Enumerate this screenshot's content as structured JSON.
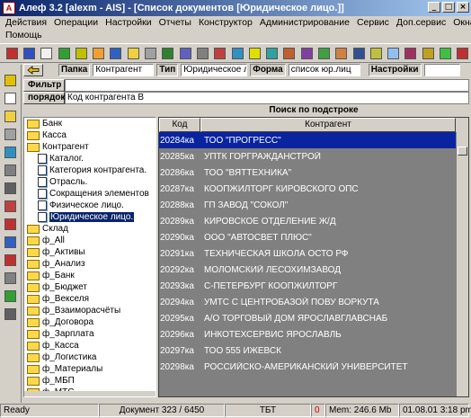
{
  "window": {
    "title": "Алеф 3.2 [alexm - AIS] - [Список документов [Юридическое лицо.]]",
    "app_icon_label": "А",
    "min_glyph": "_",
    "max_glyph": "□",
    "close_glyph": "×"
  },
  "menu": {
    "row1": [
      "Действия",
      "Операции",
      "Настройки",
      "Отчеты",
      "Конструктор",
      "Администрирование",
      "Сервис",
      "Доп.сервис",
      "Окна"
    ],
    "row2": [
      "Помощь"
    ]
  },
  "params": {
    "folder_label": "Папка",
    "folder_value": "Контрагент",
    "type_label": "Тип",
    "type_value": "Юридическое л",
    "form_label": "Форма",
    "form_value": "список юр.лиц",
    "settings_label": "Настройки"
  },
  "filter": {
    "label": "Фильтр",
    "value": ""
  },
  "order": {
    "label": "порядок",
    "value": "Код контрагента В"
  },
  "search": {
    "label": "Поиск по подстроке"
  },
  "tree": [
    {
      "label": "Банк",
      "kind": "folder",
      "indent": 0
    },
    {
      "label": "Касса",
      "kind": "folder",
      "indent": 0
    },
    {
      "label": "Контрагент",
      "kind": "folder",
      "indent": 0
    },
    {
      "label": "Каталог.",
      "kind": "doc",
      "indent": 1
    },
    {
      "label": "Категория контрагента.",
      "kind": "doc",
      "indent": 1
    },
    {
      "label": "Отрасль.",
      "kind": "doc",
      "indent": 1
    },
    {
      "label": "Сокращения элементов",
      "kind": "doc",
      "indent": 1
    },
    {
      "label": "Физическое лицо.",
      "kind": "doc",
      "indent": 1
    },
    {
      "label": "Юридическое лицо.",
      "kind": "doc",
      "indent": 1,
      "selected": true
    },
    {
      "label": "Склад",
      "kind": "folder",
      "indent": 0
    },
    {
      "label": "ф_All",
      "kind": "folder",
      "indent": 0
    },
    {
      "label": "ф_Активы",
      "kind": "folder",
      "indent": 0
    },
    {
      "label": "ф_Анализ",
      "kind": "folder",
      "indent": 0
    },
    {
      "label": "ф_Банк",
      "kind": "folder",
      "indent": 0
    },
    {
      "label": "ф_Бюджет",
      "kind": "folder",
      "indent": 0
    },
    {
      "label": "ф_Векселя",
      "kind": "folder",
      "indent": 0
    },
    {
      "label": "ф_Взаиморасчёты",
      "kind": "folder",
      "indent": 0
    },
    {
      "label": "ф_Договора",
      "kind": "folder",
      "indent": 0
    },
    {
      "label": "ф_Зарплата",
      "kind": "folder",
      "indent": 0
    },
    {
      "label": "ф_Касса",
      "kind": "folder",
      "indent": 0
    },
    {
      "label": "ф_Логистика",
      "kind": "folder",
      "indent": 0
    },
    {
      "label": "ф_Материалы",
      "kind": "folder",
      "indent": 0
    },
    {
      "label": "ф_МБП",
      "kind": "folder",
      "indent": 0
    },
    {
      "label": "ф_МТС",
      "kind": "folder",
      "indent": 0
    }
  ],
  "grid": {
    "col_code": "Код",
    "col_name": "Контрагент",
    "rows": [
      {
        "code": "20284ка",
        "name": "ТОО \"ПРОГРЕСС\"",
        "selected": true
      },
      {
        "code": "20285ка",
        "name": "УПТК ГОРГРАЖДАНСТРОЙ"
      },
      {
        "code": "20286ка",
        "name": "ТОО \"ВЯТТЕХНИКА\""
      },
      {
        "code": "20287ка",
        "name": "КООПЖИЛТОРГ КИРОВСКОГО ОПС"
      },
      {
        "code": "20288ка",
        "name": "ГП ЗАВОД \"СОКОЛ\""
      },
      {
        "code": "20289ка",
        "name": "КИРОВСКОЕ ОТДЕЛЕНИЕ Ж/Д"
      },
      {
        "code": "20290ка",
        "name": "ООО \"АВТОСВЕТ ПЛЮС\""
      },
      {
        "code": "20291ка",
        "name": "ТЕХНИЧЕСКАЯ ШКОЛА ОСТО РФ"
      },
      {
        "code": "20292ка",
        "name": "МОЛОМСКИЙ ЛЕСОХИМЗАВОД"
      },
      {
        "code": "20293ка",
        "name": "С-ПЕТЕРБУРГ КООПЖИЛТОРГ"
      },
      {
        "code": "20294ка",
        "name": "УМТС С ЦЕНТРОБАЗОЙ ПОВУ ВОРКУТА"
      },
      {
        "code": "20295ка",
        "name": "А/О ТОРГОВЫЙ ДОМ ЯРОСЛАВГЛАВСНАБ"
      },
      {
        "code": "20296ка",
        "name": "ИНКОТЕХСЕРВИС ЯРОСЛАВЛЬ"
      },
      {
        "code": "20297ка",
        "name": "ТОО 555 ИЖЕВСК"
      },
      {
        "code": "20298ка",
        "name": "РОССИЙСКО-АМЕРИКАНСКИЙ УНИВЕРСИТЕТ"
      }
    ]
  },
  "status": {
    "ready": "Ready",
    "doc_count": "Документ 323 / 6450",
    "mode": "ТБТ",
    "zero": "0",
    "mem": "Mem: 246.6 Mb",
    "datetime": "01.08.01 3:18 pm"
  },
  "colors": {
    "selection": "#0a24a0",
    "titlebar": "#0a246a",
    "folder": "#ffd84a"
  }
}
